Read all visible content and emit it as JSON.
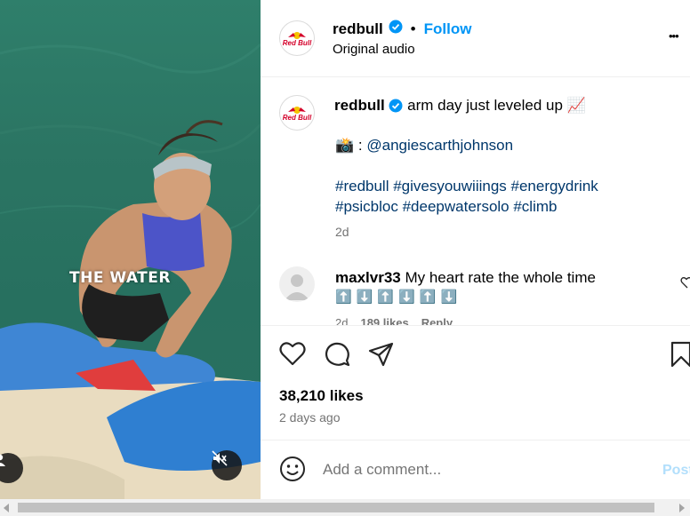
{
  "media": {
    "overlay_text": "THE WATER"
  },
  "header": {
    "username": "redbull",
    "dot": "•",
    "follow_label": "Follow",
    "audio": "Original audio",
    "more": "•••",
    "logo_text": "Red Bull"
  },
  "caption": {
    "username": "redbull",
    "text": "arm day just leveled up 📈",
    "credit_prefix": "📸 :",
    "credit_handle": "@angiescarthjohnson",
    "hashtags_line1": "#redbull #givesyouwiiings #energydrink",
    "hashtags_line2": "#psicbloc #deepwatersolo #climb",
    "time": "2d"
  },
  "comment": {
    "username": "maxlvr33",
    "text": "My heart rate the whole time",
    "arrows": [
      "⬆️",
      "⬇️",
      "⬆️",
      "⬇️",
      "⬆️",
      "⬇️"
    ],
    "time": "2d",
    "likes": "189 likes",
    "reply": "Reply"
  },
  "stats": {
    "likes": "38,210 likes",
    "date": "2 days ago"
  },
  "compose": {
    "placeholder": "Add a comment...",
    "post_label": "Post"
  },
  "colors": {
    "accent": "#0095f6",
    "link": "#00376b",
    "muted": "#737373",
    "divider": "#efefef"
  },
  "icons": [
    "heart-icon",
    "comment-icon",
    "share-icon",
    "save-icon",
    "emoji-icon",
    "verified-icon",
    "user-icon",
    "mute-icon",
    "more-icon"
  ]
}
